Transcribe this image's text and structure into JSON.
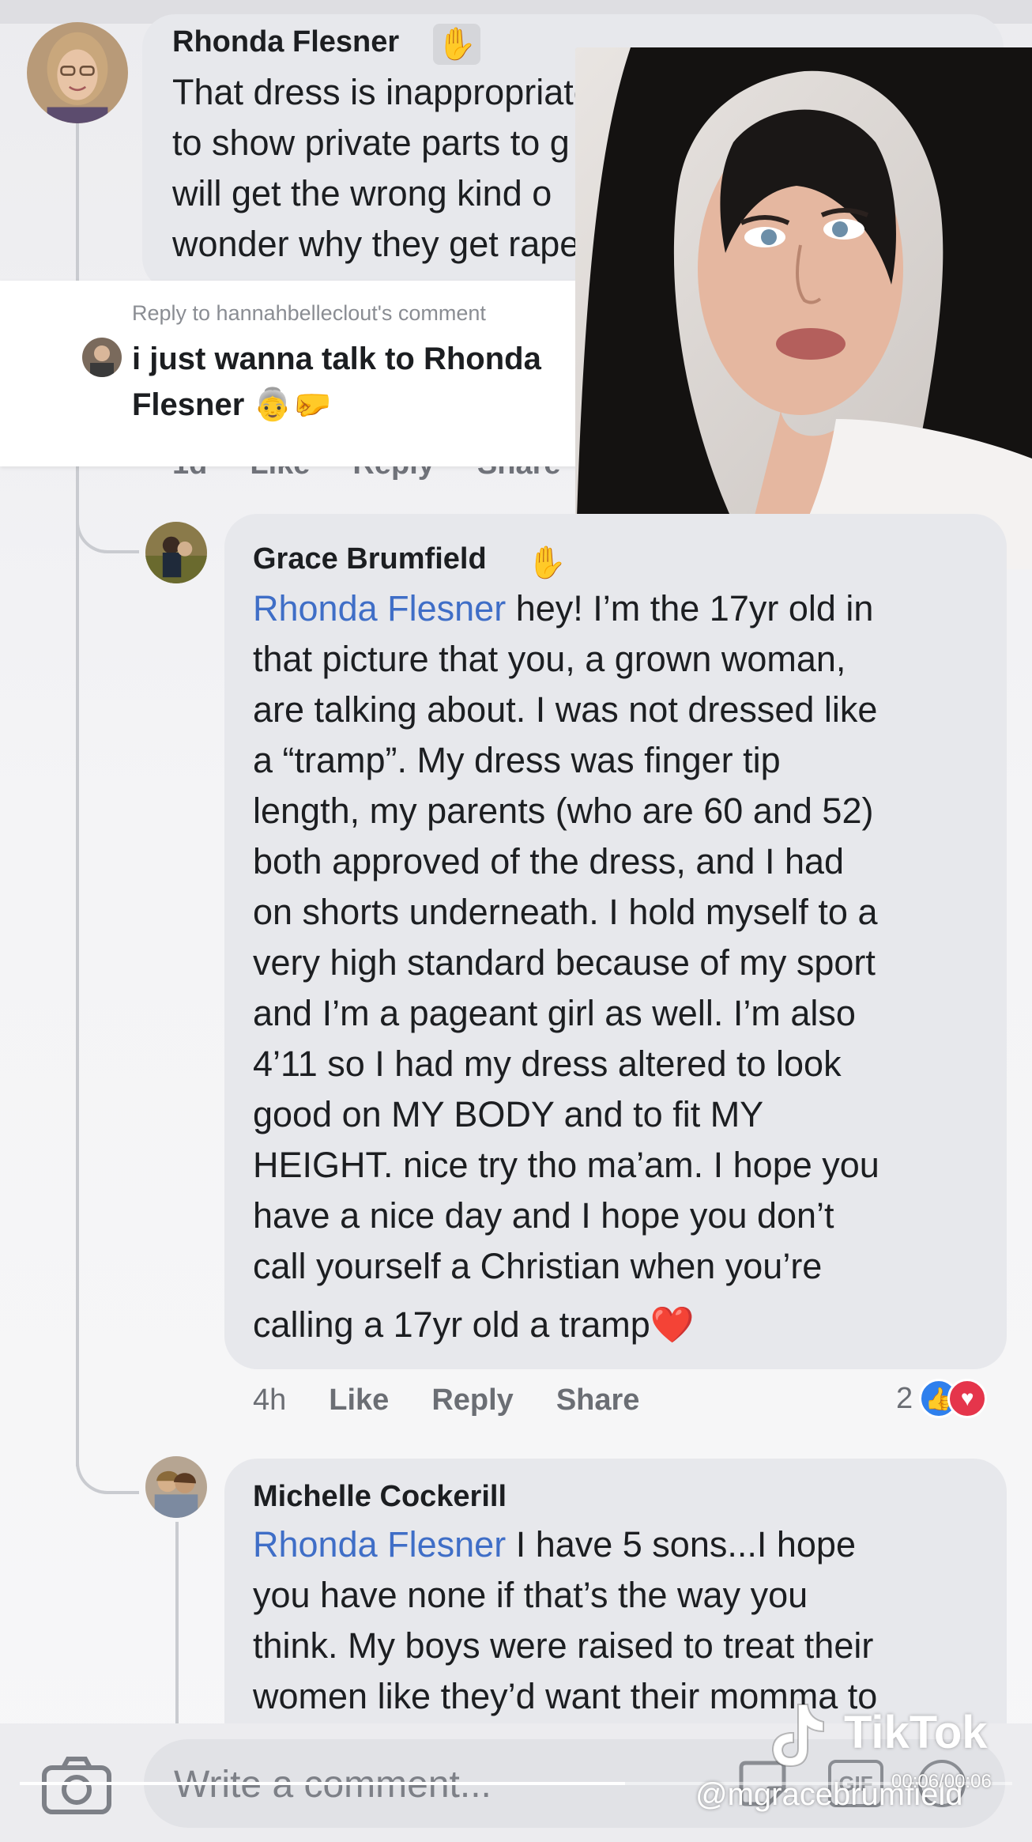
{
  "comments": [
    {
      "author": "Rhonda Flesner",
      "lines": [
        "That dress is inappropriate. Y          have",
        "to show private parts to g              ou",
        "will get the wrong kind o",
        "wonder why they get rape                ke"
      ],
      "meta": {
        "time": "1d",
        "like": "Like",
        "reply": "Reply",
        "share": "Share"
      }
    },
    {
      "author": "Grace Brumfield",
      "mention": "Rhonda Flesner",
      "lines": [
        " hey! I’m the 17yr old in",
        "that picture that you, a grown woman,",
        "are talking about. I was not dressed like",
        "a “tramp”. My dress was finger tip",
        "length, my parents (who are 60 and 52)",
        "both approved of the dress, and I had",
        "on shorts underneath. I hold myself to a",
        "very high standard because of my sport",
        "and I’m a pageant girl as well. I’m also",
        "4’11 so I had my dress altered to look",
        "good on MY BODY and to fit MY",
        "HEIGHT. nice try tho ma’am. I hope you",
        "have a nice day and I hope you don’t",
        "call yourself a Christian when you’re",
        "calling a 17yr old a tramp❤️"
      ],
      "meta": {
        "time": "4h",
        "like": "Like",
        "reply": "Reply",
        "share": "Share",
        "reaction_count": "2"
      }
    },
    {
      "author": "Michelle Cockerill",
      "mention": "Rhonda Flesner",
      "lines": [
        " I have 5 sons...I hope",
        "you have none if that’s the way you",
        "think. My boys were raised to treat their",
        "women like they’d want their momma to"
      ]
    }
  ],
  "reply_sticker": {
    "caption": "Reply to hannahbelleclout's comment",
    "text": "i just wanna talk to Rhonda Flesner 👵🤛"
  },
  "composer": {
    "placeholder": "Write a comment...",
    "gif_label": "GIF"
  },
  "tiktok": {
    "wordmark": "TikTok",
    "handle": "@mgracebrumfield",
    "time": "00:06/00:06",
    "progress": 0.61
  },
  "colors": {
    "mention": "#3f6ec7",
    "bubble": "#e7e8ec",
    "like": "#2f80ed",
    "love": "#e5354b"
  },
  "icons": [
    "wave-icon",
    "camera-icon",
    "sticker-icon",
    "gif-icon",
    "emoji-icon",
    "like-reaction-icon",
    "love-reaction-icon",
    "tiktok-logo-icon"
  ]
}
